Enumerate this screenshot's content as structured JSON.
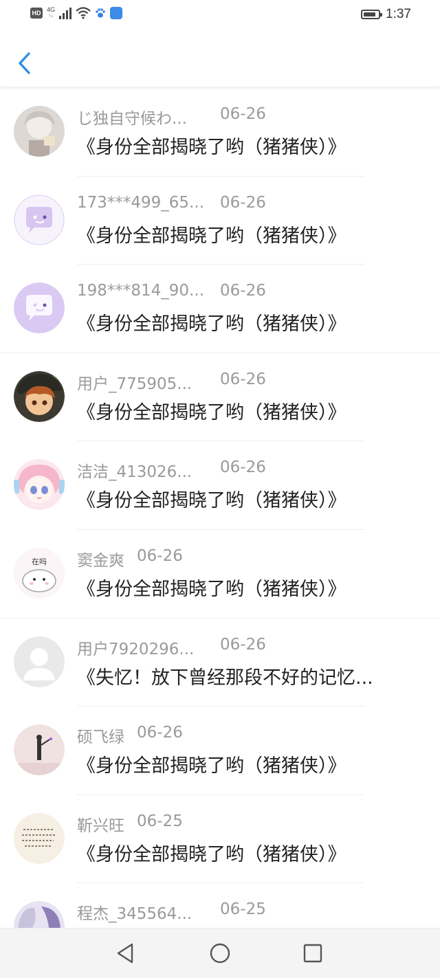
{
  "status_bar": {
    "hd": "HD",
    "network_top": "4G",
    "network_bottom": "↑↓",
    "time": "1:37",
    "battery_level": 0.85
  },
  "header": {
    "back_icon": "chevron-left-icon",
    "accent_color": "#2f8ee6"
  },
  "items": [
    {
      "name": "じ独自守候わ...",
      "date": "06-26",
      "message": "《身份全部揭晓了哟（猪猪侠）》"
    },
    {
      "name": "173***499_65...",
      "date": "06-26",
      "message": "《身份全部揭晓了哟（猪猪侠）》"
    },
    {
      "name": "198***814_90...",
      "date": "06-26",
      "message": "《身份全部揭晓了哟（猪猪侠）》"
    },
    {
      "name": "用户_775905...",
      "date": "06-26",
      "message": "《身份全部揭晓了哟（猪猪侠）》"
    },
    {
      "name": "洁洁_413026...",
      "date": "06-26",
      "message": "《身份全部揭晓了哟（猪猪侠）》"
    },
    {
      "name": "窦金爽",
      "date": "06-26",
      "message": "《身份全部揭晓了哟（猪猪侠）》",
      "avatar_text": "在吗"
    },
    {
      "name": "用户7920296...",
      "date": "06-26",
      "message": "《失忆！放下曾经那段不好的记忆..."
    },
    {
      "name": "硕飞绿",
      "date": "06-26",
      "message": "《身份全部揭晓了哟（猪猪侠）》"
    },
    {
      "name": "靳兴旺",
      "date": "06-25",
      "message": "《身份全部揭晓了哟（猪猪侠）》"
    },
    {
      "name": "程杰_345564...",
      "date": "06-25",
      "message": ""
    }
  ],
  "bottom_nav": {
    "back_icon": "triangle-back-icon",
    "home_icon": "circle-home-icon",
    "recents_icon": "square-recents-icon"
  }
}
